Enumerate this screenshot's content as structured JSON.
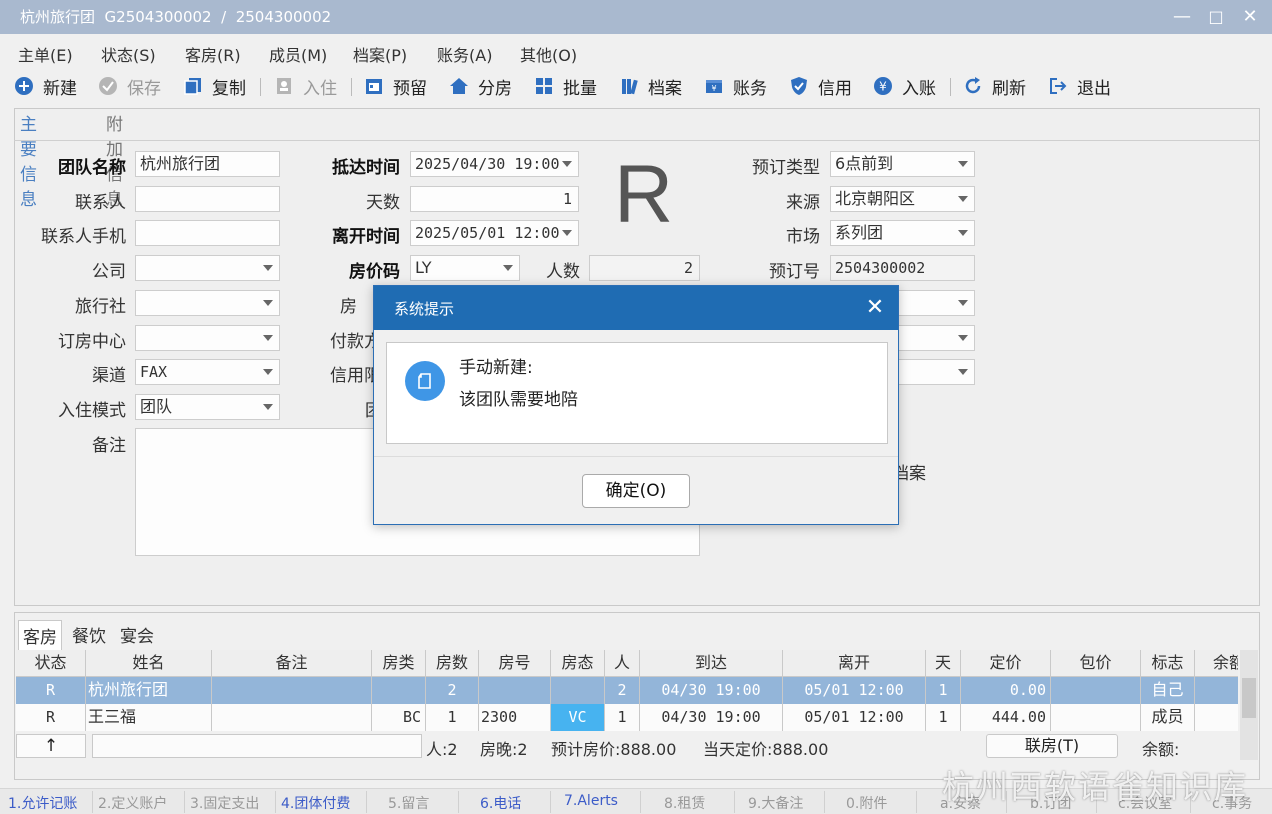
{
  "window": {
    "title": "杭州旅行团  G2504300002  /  2504300002",
    "minimize": "—",
    "maximize": "□",
    "close": "✕"
  },
  "menu": [
    "主单(E)",
    "状态(S)",
    "客房(R)",
    "成员(M)",
    "档案(P)",
    "账务(A)",
    "其他(O)"
  ],
  "toolbar": {
    "new": "新建",
    "save": "保存",
    "copy": "复制",
    "checkin": "入住",
    "reserve": "预留",
    "assign": "分房",
    "batch": "批量",
    "profile": "档案",
    "account": "账务",
    "credit": "信用",
    "post": "入账",
    "refresh": "刷新",
    "exit": "退出"
  },
  "tabs": {
    "main": "主要信息",
    "extra": "附加信息"
  },
  "form": {
    "group_name_label": "团队名称",
    "group_name": "杭州旅行团",
    "contact_label": "联系人",
    "contact": "",
    "contact_phone_label": "联系人手机",
    "contact_phone": "",
    "company_label": "公司",
    "company": "",
    "agency_label": "旅行社",
    "agency": "",
    "booking_center_label": "订房中心",
    "booking_center": "",
    "channel_label": "渠道",
    "channel": "FAX",
    "checkin_mode_label": "入住模式",
    "checkin_mode": "团队",
    "remark_label": "备注",
    "arrival_label": "抵达时间",
    "arrival": "2025/04/30 19:00",
    "days_label": "天数",
    "days": "1",
    "departure_label": "离开时间",
    "departure": "2025/05/01 12:00",
    "rate_code_label": "房价码",
    "rate_code": "LY",
    "persons_label": "人数",
    "persons": "2",
    "room_type_label_partial": "房",
    "payment_label_partial": "付款方",
    "credit_label_partial": "信用限",
    "group_label_partial": "团",
    "status_letter": "R",
    "booking_type_label": "预订类型",
    "booking_type": "6点前到",
    "source_label": "来源",
    "source": "北京朝阳区",
    "market_label": "市场",
    "market": "系列团",
    "booking_no_label": "预订号",
    "booking_no": "2504300002",
    "group_profile_partial": "团体档案",
    "confidential_partial": "保密"
  },
  "bottom_tabs": [
    "客房",
    "餐饮",
    "宴会"
  ],
  "grid": {
    "columns": [
      "状态",
      "姓名",
      "备注",
      "房类",
      "房数",
      "房号",
      "房态",
      "人",
      "到达",
      "离开",
      "天",
      "定价",
      "包价",
      "标志",
      "余额"
    ],
    "rows": [
      {
        "status": "R",
        "name": "杭州旅行团",
        "remark": "",
        "room_type": "",
        "rooms": "2",
        "room_no": "",
        "room_state": "",
        "persons": "2",
        "arrival": "04/30 19:00",
        "departure": "05/01 12:00",
        "days": "1",
        "price": "0.00",
        "package": "",
        "flag": "自己"
      },
      {
        "status": "R",
        "name": "王三福",
        "remark": "",
        "room_type": "BC",
        "rooms": "1",
        "room_no": "2300",
        "room_state": "VC",
        "persons": "1",
        "arrival": "04/30 19:00",
        "departure": "05/01 12:00",
        "days": "1",
        "price": "444.00",
        "package": "",
        "flag": "成员"
      }
    ]
  },
  "summary": {
    "up": "↑",
    "persons": "人:2",
    "room_nights": "房晚:2",
    "expected": "预计房价:888.00",
    "today": "当天定价:888.00",
    "link_button": "联房(T)",
    "balance": "余额:"
  },
  "statusbar": [
    "1.允许记账",
    "2.定义账户",
    "3.固定支出",
    "4.团体付费",
    "5.留言",
    "6.电话",
    "7.Alerts",
    "8.租赁",
    "9.大备注",
    "0.附件",
    "a.安察",
    "b.订团",
    "c.会议室",
    "c.事务"
  ],
  "watermark": "杭州西软语雀知识库",
  "dialog": {
    "title": "系统提示",
    "close": "✕",
    "line1": "手动新建:",
    "line2": "该团队需要地陪",
    "ok": "确定(O)"
  },
  "colors": {
    "titlebar": "#a9b9cf",
    "dialog_title": "#1f6cb3",
    "selected_row": "#93b5d9",
    "vc_badge": "#47b3f0",
    "status_blue": "#3c5cc8"
  }
}
